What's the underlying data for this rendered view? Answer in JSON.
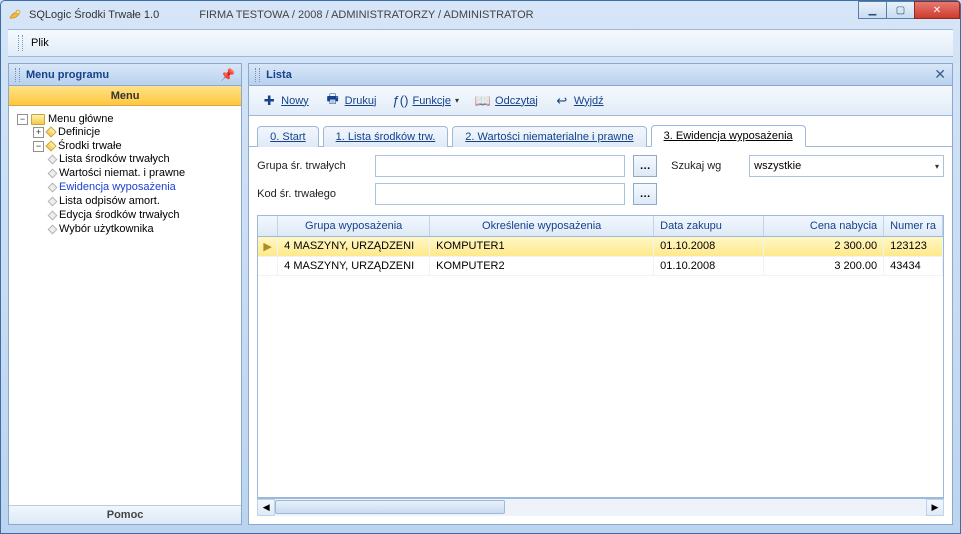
{
  "title": {
    "app": "SQLogic Środki Trwałe 1.0",
    "ctx": "FIRMA TESTOWA / 2008 / ADMINISTRATORZY /  ADMINISTRATOR"
  },
  "menubar": {
    "file": "Plik"
  },
  "left": {
    "title": "Menu programu",
    "menuTab": "Menu",
    "helpTab": "Pomoc",
    "tree": {
      "root": "Menu główne",
      "definicje": "Definicje",
      "srodki": "Środki trwałe",
      "items": [
        "Lista środków trwałych",
        "Wartości niemat. i prawne",
        "Ewidencja wyposażenia",
        "Lista odpisów amort.",
        "Edycja środków trwałych",
        "Wybór użytkownika"
      ]
    }
  },
  "right": {
    "title": "Lista",
    "toolbar": {
      "nowy": "Nowy",
      "drukuj": "Drukuj",
      "funkcje": "Funkcje",
      "odczytaj": "Odczytaj",
      "wyjdz": "Wyjdź"
    },
    "tabs": [
      "0. Start",
      "1. Lista środków trw.",
      "2. Wartości niematerialne i prawne",
      "3. Ewidencja wyposażenia"
    ],
    "filters": {
      "grupa": "Grupa śr. trwałych",
      "kod": "Kod śr. trwałego",
      "szukaj": "Szukaj wg",
      "szukajVal": "wszystkie"
    },
    "cols": [
      "",
      "Grupa wyposażenia",
      "Określenie wyposażenia",
      "Data zakupu",
      "Cena nabycia",
      "Numer ra"
    ],
    "rows": [
      {
        "grupa": "4 MASZYNY, URZĄDZENI",
        "okr": "KOMPUTER1",
        "data": "01.10.2008",
        "cena": "2 300.00",
        "nr": "123123"
      },
      {
        "grupa": "4 MASZYNY, URZĄDZENI",
        "okr": "KOMPUTER2",
        "data": "01.10.2008",
        "cena": "3 200.00",
        "nr": "43434"
      }
    ]
  }
}
